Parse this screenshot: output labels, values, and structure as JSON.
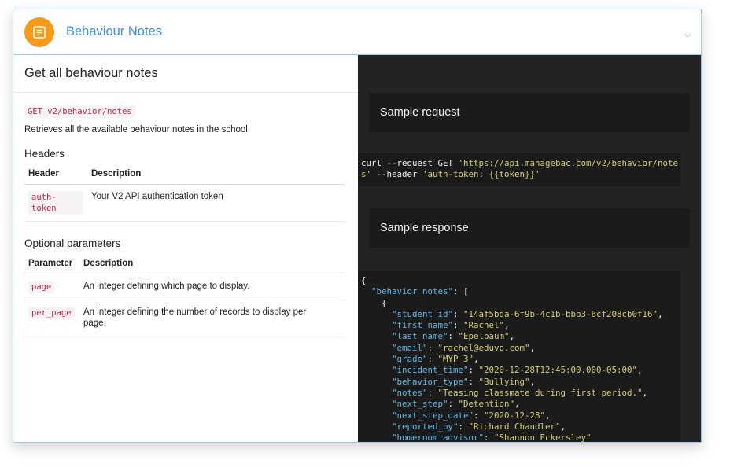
{
  "header": {
    "title": "Behaviour Notes",
    "icon": "note-icon",
    "badge_color": "#f59a1b",
    "accent_color": "#3d8fd6"
  },
  "endpoint": {
    "title": "Get all behaviour notes",
    "route": "GET v2/behavior/notes",
    "description": "Retrieves all the available behaviour notes in the school."
  },
  "headers_section": {
    "title": "Headers",
    "columns": [
      "Header",
      "Description"
    ],
    "rows": [
      {
        "name": "auth-token",
        "description": "Your V2 API authentication token"
      }
    ]
  },
  "optional_params": {
    "title": "Optional parameters",
    "columns": [
      "Parameter",
      "Description"
    ],
    "rows": [
      {
        "name": "page",
        "description": "An integer defining which page to display."
      },
      {
        "name": "per_page",
        "description": "An integer defining the number of records to display per page."
      }
    ]
  },
  "sample_request": {
    "label": "Sample request",
    "line1_cmd": "curl --request GET ",
    "line1_url": "'https://api.managebac.com/v2/behavior/note",
    "line2_url": "s'",
    "line2_cmd": " --header ",
    "line2_hdr": "'auth-token: {{token}}'"
  },
  "sample_response": {
    "label": "Sample response",
    "open_brace": "{",
    "root_key": "\"behavior_notes\"",
    "root_after": ": [",
    "item_open": "{",
    "fields": [
      {
        "key": "\"student_id\"",
        "value": "\"14af5bda-6f9b-4c1b-bbb3-6cf208cb0f16\""
      },
      {
        "key": "\"first_name\"",
        "value": "\"Rachel\""
      },
      {
        "key": "\"last_name\"",
        "value": "\"Epelbaum\""
      },
      {
        "key": "\"email\"",
        "value": "\"rachel@eduvo.com\""
      },
      {
        "key": "\"grade\"",
        "value": "\"MYP 3\""
      },
      {
        "key": "\"incident_time\"",
        "value": "\"2020-12-28T12:45:00.000-05:00\""
      },
      {
        "key": "\"behavior_type\"",
        "value": "\"Bullying\""
      },
      {
        "key": "\"notes\"",
        "value": "\"Teasing classmate during first period.\""
      },
      {
        "key": "\"next_step\"",
        "value": "\"Detention\""
      },
      {
        "key": "\"next_step_date\"",
        "value": "\"2020-12-28\""
      },
      {
        "key": "\"reported_by\"",
        "value": "\"Richard Chandler\""
      },
      {
        "key": "\"homeroom_advisor\"",
        "value": "\"Shannon Eckersley\""
      }
    ]
  }
}
